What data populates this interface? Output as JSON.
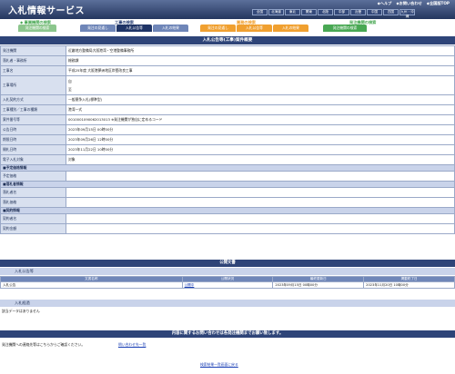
{
  "header": {
    "title": "入札情報サービス",
    "links": [
      "◆ヘルプ",
      "◆お問い合わせ",
      "◆全国版TOP"
    ],
    "regions": [
      "全国",
      "北海道",
      "東北",
      "関東",
      "北陸",
      "中部",
      "近畿",
      "中国",
      "四国",
      "九州・沖縄"
    ]
  },
  "tabbar": {
    "section_left": "◆ 事業機関の検索",
    "section_construction": "工事の検索",
    "section_service": "業務の検索",
    "section_agency": "発注機関の検索",
    "tabs": [
      "発注機関の検索",
      "発注の見通し",
      "入札公告等",
      "入札の結果",
      "発注の見通し",
      "入札公告等",
      "入札の結果",
      "発注機関の検索"
    ]
  },
  "page_title": "入札公告等(工事)案件概要",
  "detail_rows": [
    {
      "label": "発注機関",
      "value": "近畿地方整備局大阪港湾・空港整備事務所"
    },
    {
      "label": "落札者・事務所",
      "value": "総務課"
    },
    {
      "label": "工事名",
      "value": "平成25年度 大阪港夢洲地区岸壁改良工事"
    },
    {
      "label": "工事場所",
      "value": "自\n至"
    },
    {
      "label": "入札契約方式",
      "value": "一般競争入札(標準型)"
    },
    {
      "label": "工事種別／工事の種類",
      "value": "港湾一式"
    },
    {
      "label": "案件番号等",
      "value": "0010001090062013013 ※発注機関が独自に定めるコード"
    },
    {
      "label": "公告日時",
      "value": "2023年09月15日 00時00分"
    },
    {
      "label": "期限日時",
      "value": "2023年09月26日 12時00分"
    },
    {
      "label": "開札日時",
      "value": "2023年11月22日 10時00分"
    },
    {
      "label": "電子入札対象",
      "value": "対象"
    }
  ],
  "sections": {
    "plan": "■予定価格情報",
    "plan_label": "予定価格",
    "winner": "■落札者情報",
    "winner_name": "落札者名",
    "winner_price": "落札価格",
    "contract": "■契約情報",
    "contract_party": "契約者名",
    "contract_amount": "契約金額"
  },
  "public_docs": {
    "title": "公開文書",
    "subheading": "入札公告等",
    "columns": [
      "文書名称",
      "公開状況",
      "最終更新日",
      "掲載終了日"
    ],
    "rows": [
      {
        "name": "入札公告",
        "status": "公開中",
        "updated": "2023年09月15日 00時00分",
        "end": "2023年11月20日 10時00分"
      }
    ],
    "results_heading": "入札経過",
    "results_note": "該当データはありません"
  },
  "contact": {
    "bar": "内容に関するお問い合わせは各発注機関までお願い致します。",
    "text": "発注機関への連絡先等はこちらからご確認ください。",
    "link": "問い合わせ先一覧"
  },
  "footer_link": "検索結果一覧画面に戻る"
}
